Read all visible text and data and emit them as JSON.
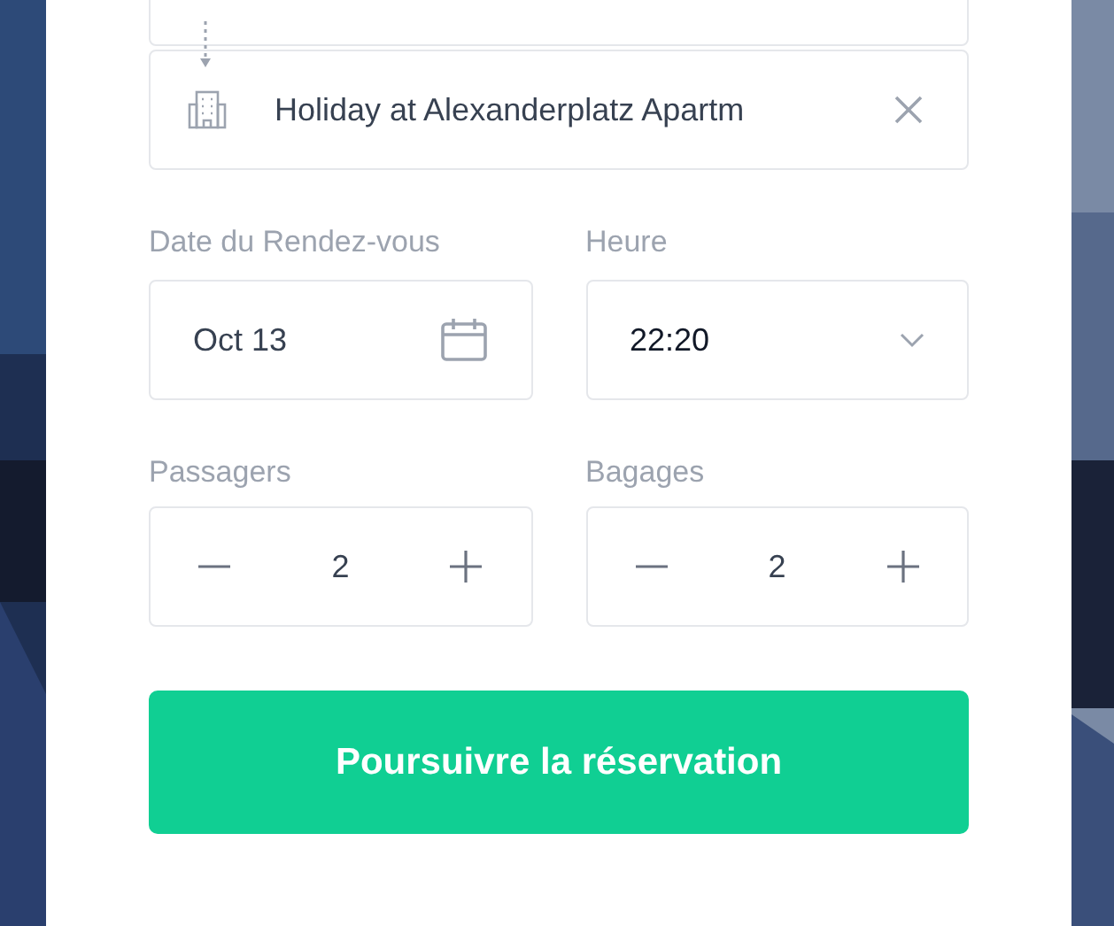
{
  "destination": {
    "value": "Holiday at Alexanderplatz Apartm"
  },
  "date": {
    "label": "Date du Rendez-vous",
    "value": "Oct 13"
  },
  "time": {
    "label": "Heure",
    "value": "22:20"
  },
  "counters": [
    {
      "label": "Passagers",
      "value": "2"
    },
    {
      "label": "Bagages",
      "value": "2"
    }
  ],
  "submit": "Poursuivre la réservation"
}
